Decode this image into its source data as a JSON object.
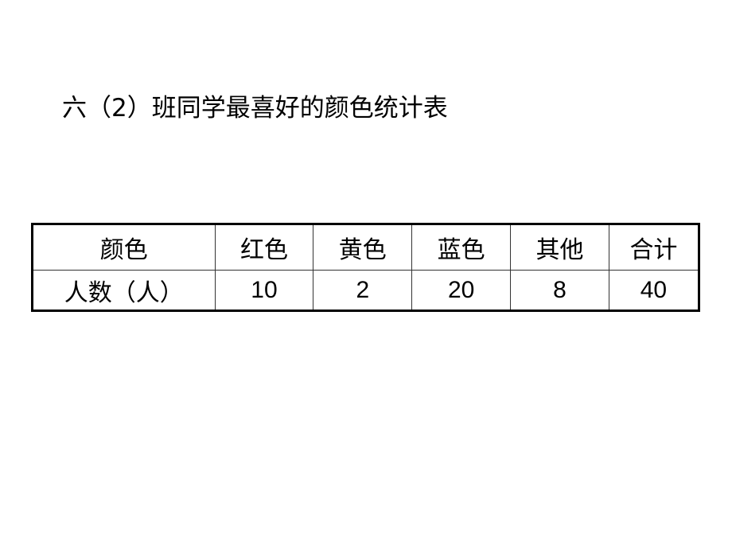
{
  "title": "六（2）班同学最喜好的颜色统计表",
  "table": {
    "header": [
      "颜色",
      "红色",
      "黄色",
      "蓝色",
      "其他",
      "合计"
    ],
    "row": [
      "人数（人）",
      "10",
      "2",
      "20",
      "8",
      "40"
    ]
  }
}
